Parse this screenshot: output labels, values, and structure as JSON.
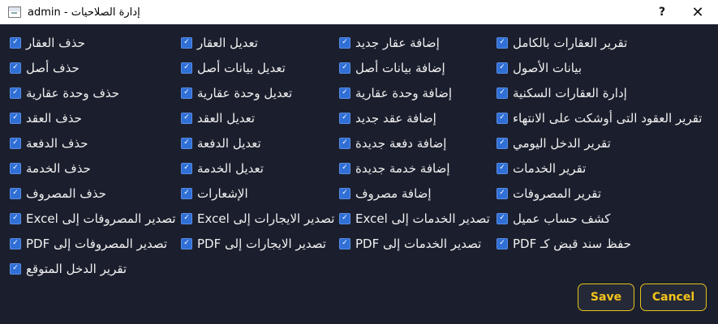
{
  "window": {
    "title": "admin - إدارة الصلاحيات",
    "help_label": "?",
    "close_label": "✕"
  },
  "checkbox_mark": "✓",
  "rows": [
    [
      "حذف العقار",
      "تعديل العقار",
      "إضافة عقار جديد",
      "تقرير العقارات بالكامل"
    ],
    [
      "حذف أصل",
      "تعديل بيانات أصل",
      "إضافة بيانات أصل",
      "بيانات الأصول"
    ],
    [
      "حذف وحدة عقارية",
      "تعديل وحدة عقارية",
      "إضافة وحدة عقارية",
      "إدارة العقارات السكنية"
    ],
    [
      "حذف العقد",
      "تعديل العقد",
      "إضافة عقد جديد",
      "تقرير العقود التى أوشكت على الانتهاء"
    ],
    [
      "حذف الدفعة",
      "تعديل الدفعة",
      "إضافة دفعة جديدة",
      "تقرير الدخل اليومي"
    ],
    [
      "حذف الخدمة",
      "تعديل الخدمة",
      "إضافة خدمة جديدة",
      "تقرير الخدمات"
    ],
    [
      "حذف المصروف",
      "الإشعارات",
      "إضافة مصروف",
      "تقرير المصروفات"
    ],
    [
      "Excel تصدير المصروفات إلى",
      "Excel تصدير الايجارات إلى",
      "Excel تصدير الخدمات إلى",
      "كشف حساب عميل"
    ],
    [
      "PDF تصدير المصروفات إلى",
      "PDF تصدير الايجارات إلى",
      "PDF تصدير الخدمات إلى",
      "PDF حفظ سند قبض كـ"
    ],
    [
      "تقرير الدخل المتوقع"
    ]
  ],
  "buttons": {
    "save_label": "Save",
    "cancel_label": "Cancel"
  },
  "colors": {
    "background": "#1b1f2d",
    "checkbox": "#2f6fd6",
    "button_text": "#f3c41b",
    "button_border": "#e6c21a"
  }
}
